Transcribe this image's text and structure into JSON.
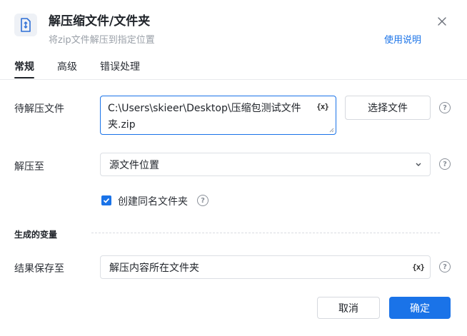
{
  "header": {
    "title": "解压缩文件/文件夹",
    "subtitle": "将zip文件解压到指定位置",
    "help_link": "使用说明",
    "icon": "unzip-file-icon",
    "close_icon": "close-icon"
  },
  "tabs": [
    {
      "label": "常规",
      "active": true
    },
    {
      "label": "高级",
      "active": false
    },
    {
      "label": "错误处理",
      "active": false
    }
  ],
  "form": {
    "source_file": {
      "label": "待解压文件",
      "value": "C:\\Users\\skieer\\Desktop\\压缩包测试文件夹.zip",
      "variable_icon": "{x}",
      "select_button": "选择文件"
    },
    "extract_to": {
      "label": "解压至",
      "selected": "源文件位置"
    },
    "create_folder": {
      "label": "创建同名文件夹",
      "checked": true
    }
  },
  "variables": {
    "section_title": "生成的变量",
    "result": {
      "label": "结果保存至",
      "value": "解压内容所在文件夹",
      "variable_icon": "{x}"
    }
  },
  "footer": {
    "cancel": "取消",
    "confirm": "确定"
  },
  "colors": {
    "primary": "#1a73e8",
    "text": "#1f2329",
    "muted": "#9aa0a8"
  }
}
